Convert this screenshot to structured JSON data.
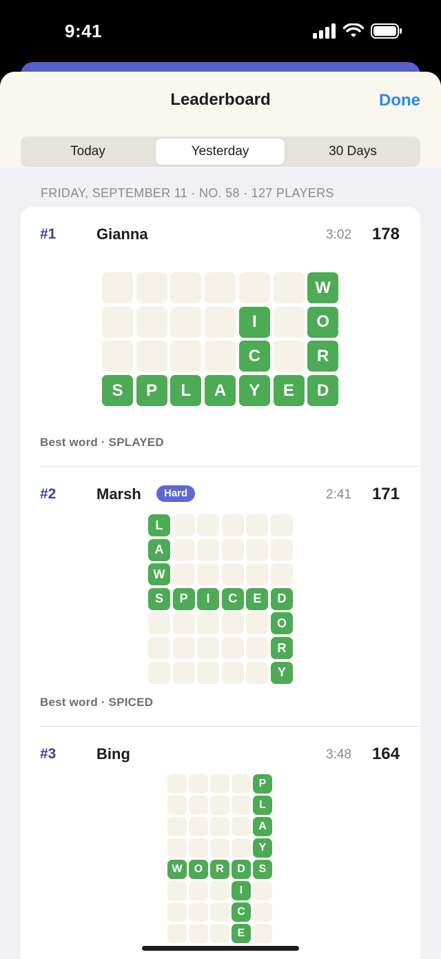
{
  "status": {
    "time": "9:41"
  },
  "header": {
    "title": "Leaderboard",
    "done_label": "Done"
  },
  "tabs": [
    {
      "label": "Today",
      "active": false
    },
    {
      "label": "Yesterday",
      "active": true
    },
    {
      "label": "30 Days",
      "active": false
    }
  ],
  "meta": "FRIDAY, SEPTEMBER 11 · NO. 58 · 127 PLAYERS",
  "colors": {
    "accent": "#2a8be8",
    "rank": "#3f3f9b",
    "tile_green": "#4daa55",
    "tile_empty": "#f6f2e8",
    "hard_badge": "#5e67d3"
  },
  "entries": [
    {
      "rank": "#1",
      "name": "Gianna",
      "badge": "",
      "time": "3:02",
      "score": "178",
      "best": "Best word · SPLAYED",
      "board": [
        "______W",
        "____I_O",
        "____C_R",
        "SPLAYED"
      ]
    },
    {
      "rank": "#2",
      "name": "Marsh",
      "badge": "Hard",
      "time": "2:41",
      "score": "171",
      "best": "Best word · SPICED",
      "board": [
        "L_____",
        "A_____",
        "W_____",
        "SPICED",
        "_____O",
        "_____R",
        "_____Y"
      ]
    },
    {
      "rank": "#3",
      "name": "Bing",
      "badge": "",
      "time": "3:48",
      "score": "164",
      "best": "",
      "board": [
        "____P",
        "____L",
        "____A",
        "____Y",
        "WORDS",
        "___I_",
        "___C_",
        "___E_"
      ]
    }
  ]
}
